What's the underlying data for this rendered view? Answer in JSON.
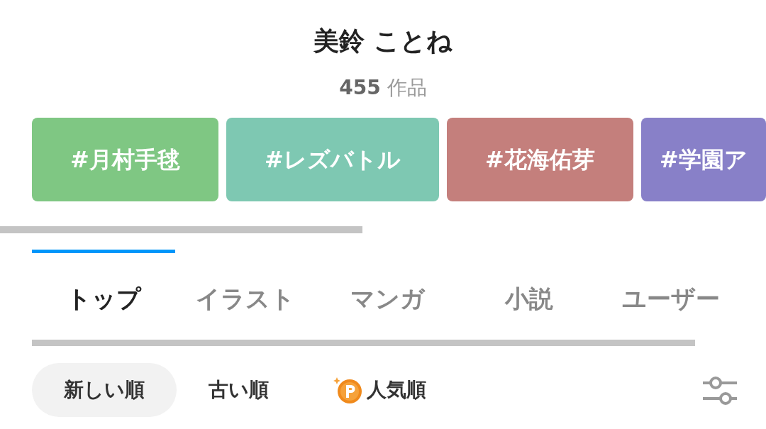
{
  "title": "美鈴 ことね",
  "work_count": {
    "number": "455",
    "unit": "作品"
  },
  "tags": [
    {
      "label": "#月村手毬",
      "color": "#7fc783"
    },
    {
      "label": "#レズバトル",
      "color": "#7ec8b2"
    },
    {
      "label": "#花海佑芽",
      "color": "#c47f7c"
    },
    {
      "label": "#学園ア",
      "color": "#8880c8"
    }
  ],
  "tabs": [
    {
      "label": "トップ",
      "selected": true
    },
    {
      "label": "イラスト",
      "selected": false
    },
    {
      "label": "マンガ",
      "selected": false
    },
    {
      "label": "小説",
      "selected": false
    },
    {
      "label": "ユーザー",
      "selected": false
    }
  ],
  "sort_options": [
    {
      "label": "新しい順",
      "selected": true
    },
    {
      "label": "古い順",
      "selected": false
    },
    {
      "label": "人気順",
      "selected": false,
      "kind": "premium"
    }
  ]
}
